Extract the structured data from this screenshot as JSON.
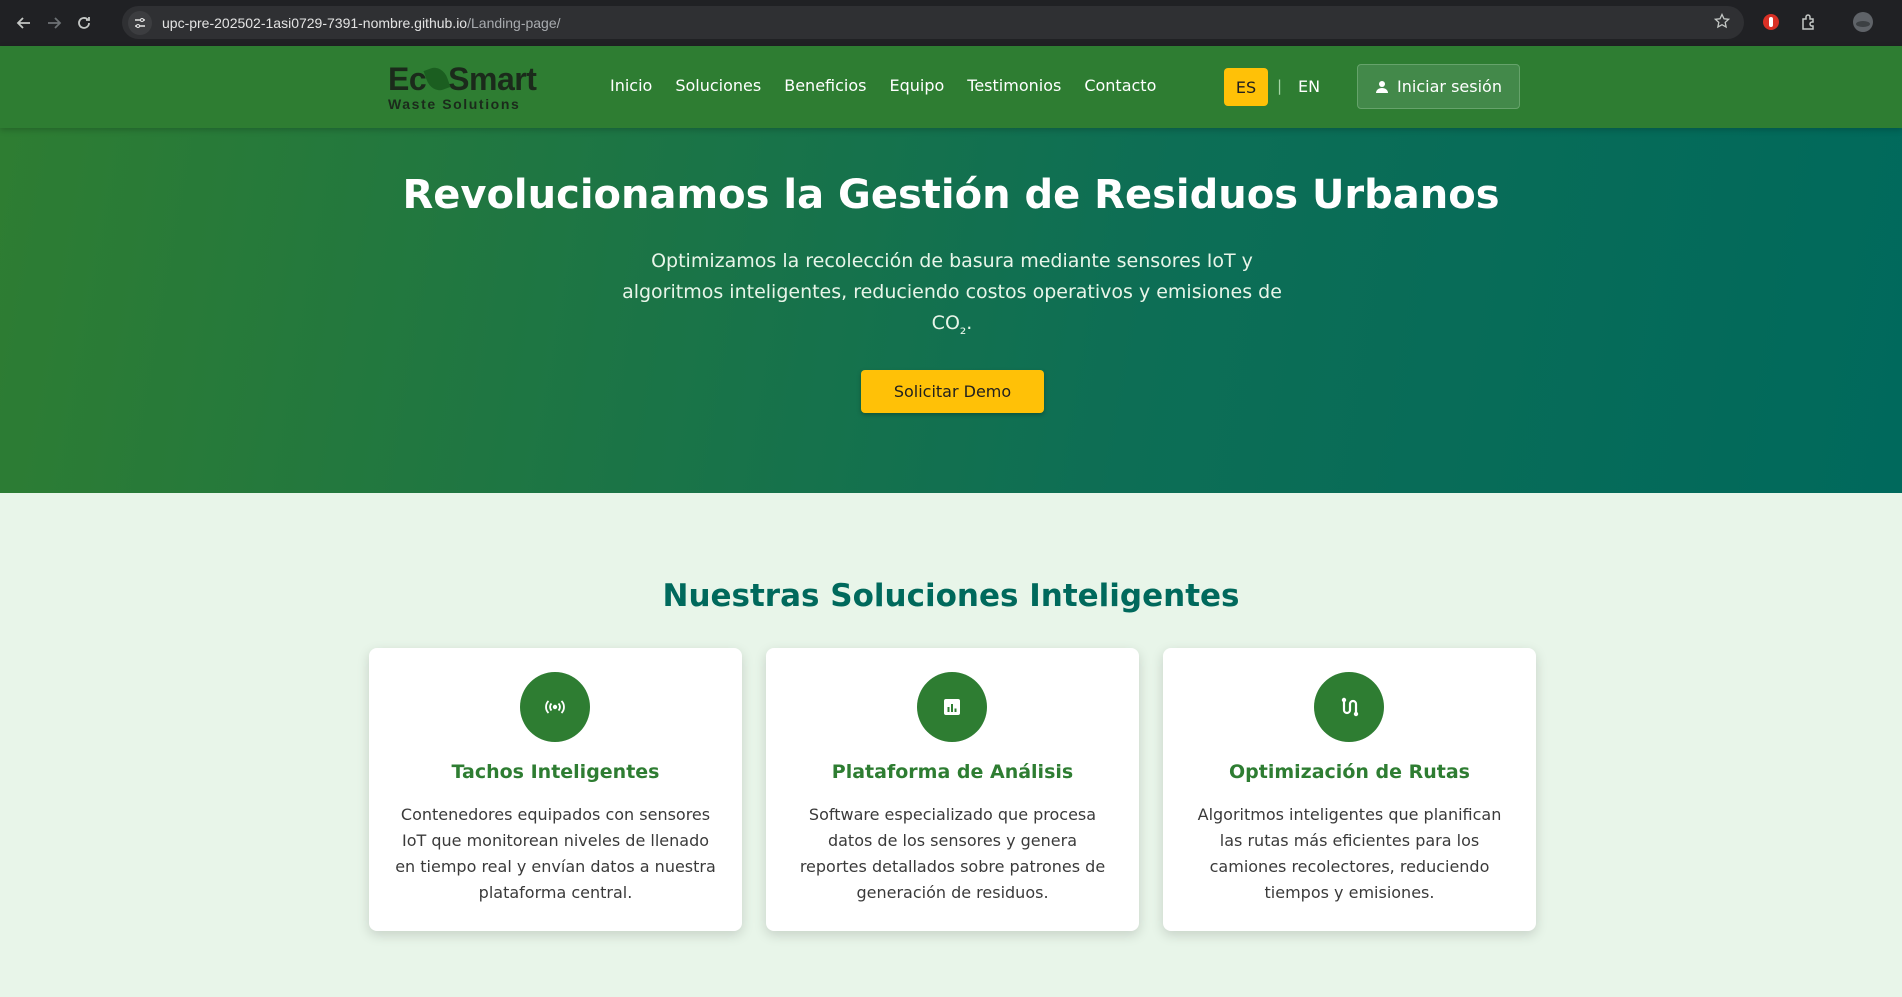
{
  "browser": {
    "url_host": "upc-pre-202502-1asi0729-7391-nombre.github.io",
    "url_path": "/Landing-page/"
  },
  "header": {
    "logo_main_a": "Ec",
    "logo_main_b": "Smart",
    "logo_sub": "Waste Solutions",
    "nav": [
      "Inicio",
      "Soluciones",
      "Beneficios",
      "Equipo",
      "Testimonios",
      "Contacto"
    ],
    "lang_active": "ES",
    "lang_sep": "|",
    "lang_other": "EN",
    "login_label": "Iniciar sesión"
  },
  "hero": {
    "title": "Revolucionamos la Gestión de Residuos Urbanos",
    "subtitle_before": "Optimizamos la recolección de basura mediante sensores IoT y algoritmos inteligentes, reduciendo costos operativos y emisiones de CO",
    "subtitle_sub": "₂",
    "subtitle_after": ".",
    "cta": "Solicitar Demo"
  },
  "solutions": {
    "title": "Nuestras Soluciones Inteligentes",
    "cards": [
      {
        "icon": "sensors-icon",
        "title": "Tachos Inteligentes",
        "text": "Contenedores equipados con sensores IoT que monitorean niveles de llenado en tiempo real y envían datos a nuestra plataforma central."
      },
      {
        "icon": "analytics-icon",
        "title": "Plataforma de Análisis",
        "text": "Software especializado que procesa datos de los sensores y genera reportes detallados sobre patrones de generación de residuos."
      },
      {
        "icon": "route-icon",
        "title": "Optimización de Rutas",
        "text": "Algoritmos inteligentes que planifican las rutas más eficientes para los camiones recolectores, reduciendo tiempos y emisiones."
      }
    ]
  },
  "colors": {
    "primary": "#2e7d32",
    "teal": "#00695c",
    "accent": "#ffc107",
    "background": "#e8f5e9"
  }
}
